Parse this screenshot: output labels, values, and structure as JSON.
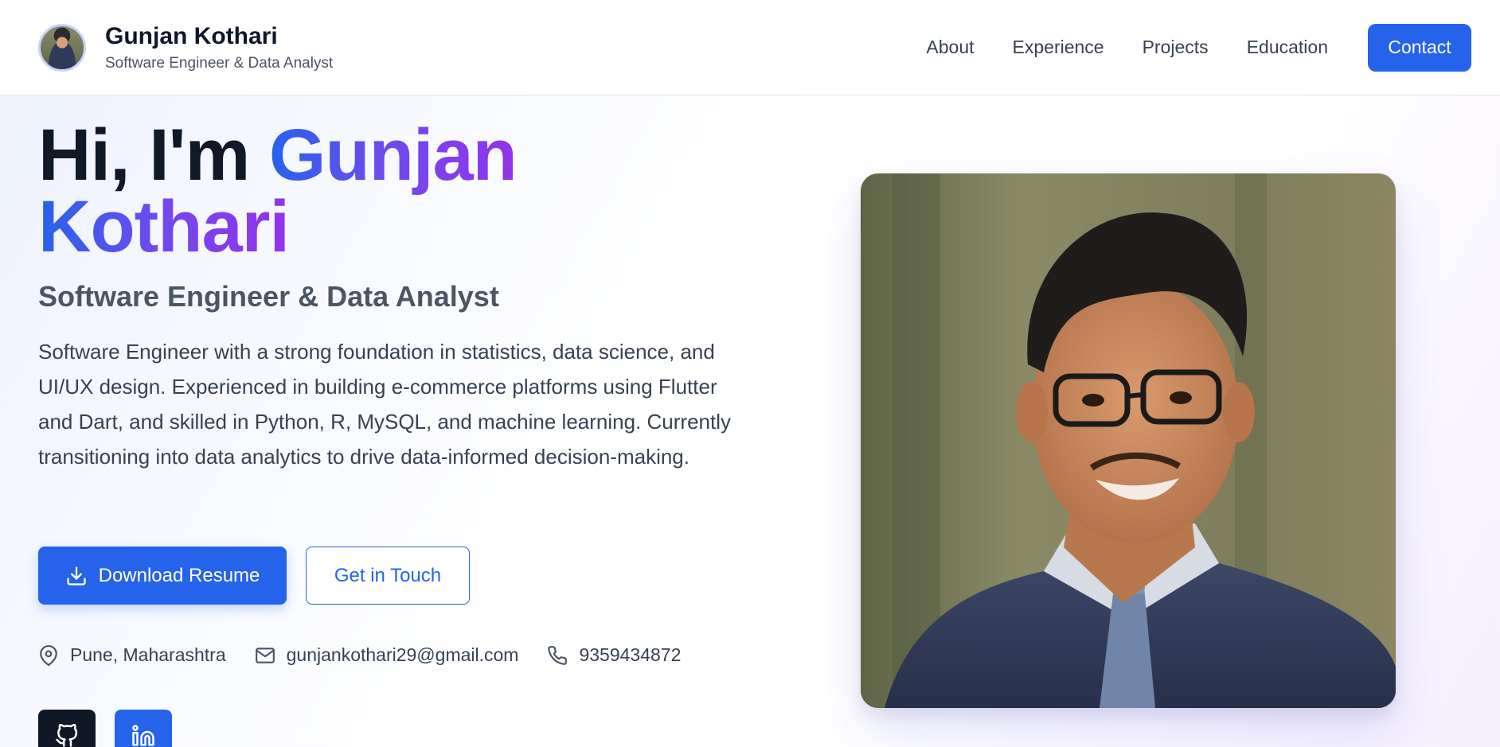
{
  "header": {
    "name": "Gunjan Kothari",
    "subtitle": "Software Engineer & Data Analyst",
    "nav": [
      {
        "label": "About"
      },
      {
        "label": "Experience"
      },
      {
        "label": "Projects"
      },
      {
        "label": "Education"
      }
    ],
    "contact_label": "Contact"
  },
  "hero": {
    "greeting": "Hi, I'm ",
    "first_name": "Gunjan",
    "last_name": "Kothari",
    "role": "Software Engineer & Data Analyst",
    "description": "Software Engineer with a strong foundation in statistics, data science, and UI/UX design. Experienced in building e-commerce platforms using Flutter and Dart, and skilled in Python, R, MySQL, and machine learning. Currently transitioning into data analytics to drive data-informed decision-making.",
    "download_label": "Download Resume",
    "touch_label": "Get in Touch"
  },
  "contact_info": {
    "location": "Pune, Maharashtra",
    "email": "gunjankothari29@gmail.com",
    "phone": "9359434872"
  },
  "social": {
    "github_icon": "github-icon",
    "linkedin_icon": "linkedin-icon"
  },
  "colors": {
    "accent": "#2563eb",
    "gradient_start": "#2563eb",
    "gradient_end": "#9333ea"
  }
}
